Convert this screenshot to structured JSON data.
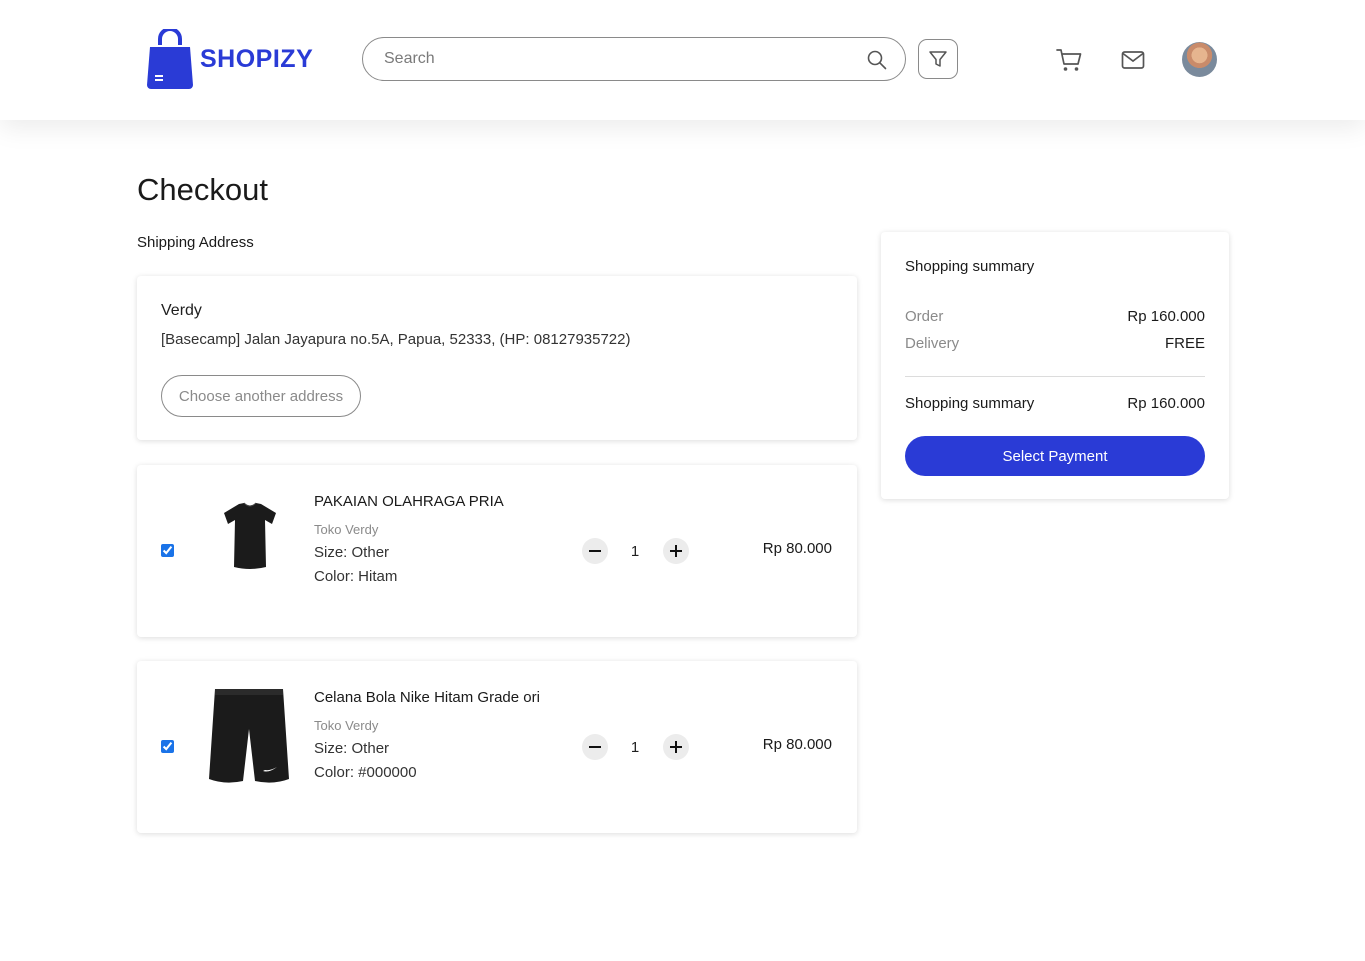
{
  "brand": {
    "name": "SHOPIZY",
    "color": "#2a3bd6"
  },
  "header": {
    "search_placeholder": "Search",
    "icons": [
      "search-icon",
      "filter-icon",
      "cart-icon",
      "mail-icon",
      "avatar"
    ]
  },
  "page": {
    "title": "Checkout",
    "shipping_label": "Shipping Address"
  },
  "address": {
    "name": "Verdy",
    "line": "[Basecamp] Jalan Jayapura no.5A, Papua, 52333, (HP: 08127935722)",
    "change_button": "Choose another address"
  },
  "items": [
    {
      "checked": true,
      "name": "PAKAIAN OLAHRAGA PRIA",
      "store": "Toko Verdy",
      "size": "Size: Other",
      "color": "Color: Hitam",
      "quantity": "1",
      "price": "Rp 80.000",
      "image": "black-tshirt"
    },
    {
      "checked": true,
      "name": "Celana Bola Nike Hitam Grade ori",
      "store": "Toko Verdy",
      "size": "Size: Other",
      "color": "Color: #000000",
      "quantity": "1",
      "price": "Rp 80.000",
      "image": "black-shorts"
    }
  ],
  "summary": {
    "title": "Shopping summary",
    "order_label": "Order",
    "order_value": "Rp 160.000",
    "delivery_label": "Delivery",
    "delivery_value": "FREE",
    "total_label": "Shopping summary",
    "total_value": "Rp 160.000",
    "pay_button": "Select Payment"
  }
}
